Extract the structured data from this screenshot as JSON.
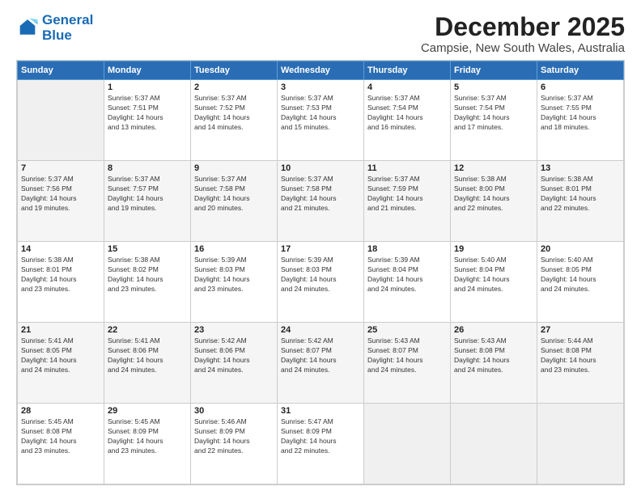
{
  "logo": {
    "line1": "General",
    "line2": "Blue"
  },
  "title": "December 2025",
  "subtitle": "Campsie, New South Wales, Australia",
  "days_header": [
    "Sunday",
    "Monday",
    "Tuesday",
    "Wednesday",
    "Thursday",
    "Friday",
    "Saturday"
  ],
  "weeks": [
    [
      {
        "day": "",
        "info": ""
      },
      {
        "day": "1",
        "info": "Sunrise: 5:37 AM\nSunset: 7:51 PM\nDaylight: 14 hours\nand 13 minutes."
      },
      {
        "day": "2",
        "info": "Sunrise: 5:37 AM\nSunset: 7:52 PM\nDaylight: 14 hours\nand 14 minutes."
      },
      {
        "day": "3",
        "info": "Sunrise: 5:37 AM\nSunset: 7:53 PM\nDaylight: 14 hours\nand 15 minutes."
      },
      {
        "day": "4",
        "info": "Sunrise: 5:37 AM\nSunset: 7:54 PM\nDaylight: 14 hours\nand 16 minutes."
      },
      {
        "day": "5",
        "info": "Sunrise: 5:37 AM\nSunset: 7:54 PM\nDaylight: 14 hours\nand 17 minutes."
      },
      {
        "day": "6",
        "info": "Sunrise: 5:37 AM\nSunset: 7:55 PM\nDaylight: 14 hours\nand 18 minutes."
      }
    ],
    [
      {
        "day": "7",
        "info": "Sunrise: 5:37 AM\nSunset: 7:56 PM\nDaylight: 14 hours\nand 19 minutes."
      },
      {
        "day": "8",
        "info": "Sunrise: 5:37 AM\nSunset: 7:57 PM\nDaylight: 14 hours\nand 19 minutes."
      },
      {
        "day": "9",
        "info": "Sunrise: 5:37 AM\nSunset: 7:58 PM\nDaylight: 14 hours\nand 20 minutes."
      },
      {
        "day": "10",
        "info": "Sunrise: 5:37 AM\nSunset: 7:58 PM\nDaylight: 14 hours\nand 21 minutes."
      },
      {
        "day": "11",
        "info": "Sunrise: 5:37 AM\nSunset: 7:59 PM\nDaylight: 14 hours\nand 21 minutes."
      },
      {
        "day": "12",
        "info": "Sunrise: 5:38 AM\nSunset: 8:00 PM\nDaylight: 14 hours\nand 22 minutes."
      },
      {
        "day": "13",
        "info": "Sunrise: 5:38 AM\nSunset: 8:01 PM\nDaylight: 14 hours\nand 22 minutes."
      }
    ],
    [
      {
        "day": "14",
        "info": "Sunrise: 5:38 AM\nSunset: 8:01 PM\nDaylight: 14 hours\nand 23 minutes."
      },
      {
        "day": "15",
        "info": "Sunrise: 5:38 AM\nSunset: 8:02 PM\nDaylight: 14 hours\nand 23 minutes."
      },
      {
        "day": "16",
        "info": "Sunrise: 5:39 AM\nSunset: 8:03 PM\nDaylight: 14 hours\nand 23 minutes."
      },
      {
        "day": "17",
        "info": "Sunrise: 5:39 AM\nSunset: 8:03 PM\nDaylight: 14 hours\nand 24 minutes."
      },
      {
        "day": "18",
        "info": "Sunrise: 5:39 AM\nSunset: 8:04 PM\nDaylight: 14 hours\nand 24 minutes."
      },
      {
        "day": "19",
        "info": "Sunrise: 5:40 AM\nSunset: 8:04 PM\nDaylight: 14 hours\nand 24 minutes."
      },
      {
        "day": "20",
        "info": "Sunrise: 5:40 AM\nSunset: 8:05 PM\nDaylight: 14 hours\nand 24 minutes."
      }
    ],
    [
      {
        "day": "21",
        "info": "Sunrise: 5:41 AM\nSunset: 8:05 PM\nDaylight: 14 hours\nand 24 minutes."
      },
      {
        "day": "22",
        "info": "Sunrise: 5:41 AM\nSunset: 8:06 PM\nDaylight: 14 hours\nand 24 minutes."
      },
      {
        "day": "23",
        "info": "Sunrise: 5:42 AM\nSunset: 8:06 PM\nDaylight: 14 hours\nand 24 minutes."
      },
      {
        "day": "24",
        "info": "Sunrise: 5:42 AM\nSunset: 8:07 PM\nDaylight: 14 hours\nand 24 minutes."
      },
      {
        "day": "25",
        "info": "Sunrise: 5:43 AM\nSunset: 8:07 PM\nDaylight: 14 hours\nand 24 minutes."
      },
      {
        "day": "26",
        "info": "Sunrise: 5:43 AM\nSunset: 8:08 PM\nDaylight: 14 hours\nand 24 minutes."
      },
      {
        "day": "27",
        "info": "Sunrise: 5:44 AM\nSunset: 8:08 PM\nDaylight: 14 hours\nand 23 minutes."
      }
    ],
    [
      {
        "day": "28",
        "info": "Sunrise: 5:45 AM\nSunset: 8:08 PM\nDaylight: 14 hours\nand 23 minutes."
      },
      {
        "day": "29",
        "info": "Sunrise: 5:45 AM\nSunset: 8:09 PM\nDaylight: 14 hours\nand 23 minutes."
      },
      {
        "day": "30",
        "info": "Sunrise: 5:46 AM\nSunset: 8:09 PM\nDaylight: 14 hours\nand 22 minutes."
      },
      {
        "day": "31",
        "info": "Sunrise: 5:47 AM\nSunset: 8:09 PM\nDaylight: 14 hours\nand 22 minutes."
      },
      {
        "day": "",
        "info": ""
      },
      {
        "day": "",
        "info": ""
      },
      {
        "day": "",
        "info": ""
      }
    ]
  ]
}
